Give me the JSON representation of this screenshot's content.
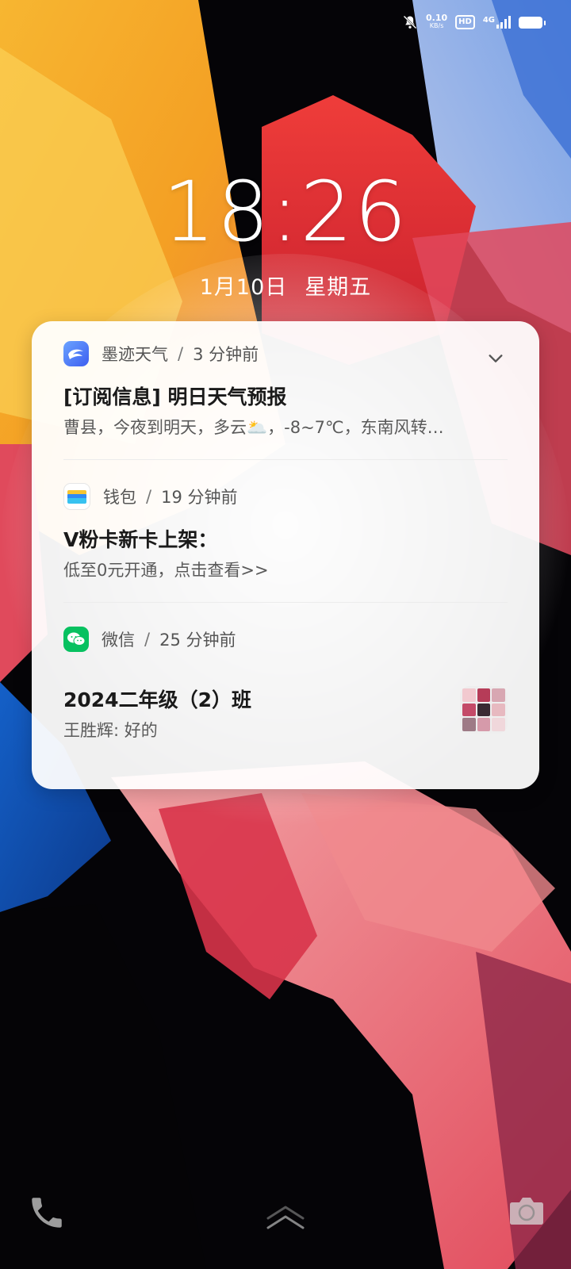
{
  "status_bar": {
    "speed_value": "0.10",
    "speed_unit": "KB/s",
    "hd": "HD",
    "network": "4G"
  },
  "lockscreen": {
    "time": "18:26",
    "date": "1月10日",
    "weekday": "星期五"
  },
  "notifications": [
    {
      "app": "墨迹天气",
      "time_ago": "3 分钟前",
      "title": "[订阅信息] 明日天气预报",
      "body": "曹县，今夜到明天，多云🌥️，-8~7℃，东南风转…"
    },
    {
      "app": "钱包",
      "time_ago": "19 分钟前",
      "title": "V粉卡新卡上架：",
      "body": "低至0元开通，点击查看>>"
    },
    {
      "app": "微信",
      "time_ago": "25 分钟前",
      "title": "2024二年级（2）班",
      "body": "王胜辉: 好的"
    }
  ],
  "separator": "/",
  "icons": {
    "mute": "bell-slash-icon",
    "weather_app": "mojiweather-icon",
    "wallet_app": "wallet-icon",
    "wechat_app": "wechat-icon",
    "expand": "chevron-down-icon",
    "phone": "phone-icon",
    "unlock": "swipe-up-icon",
    "camera": "camera-icon"
  },
  "colors": {
    "card_bg": "#FFFFFF",
    "wechat_green": "#07C160",
    "weather_blue": "#4A7BF7"
  }
}
